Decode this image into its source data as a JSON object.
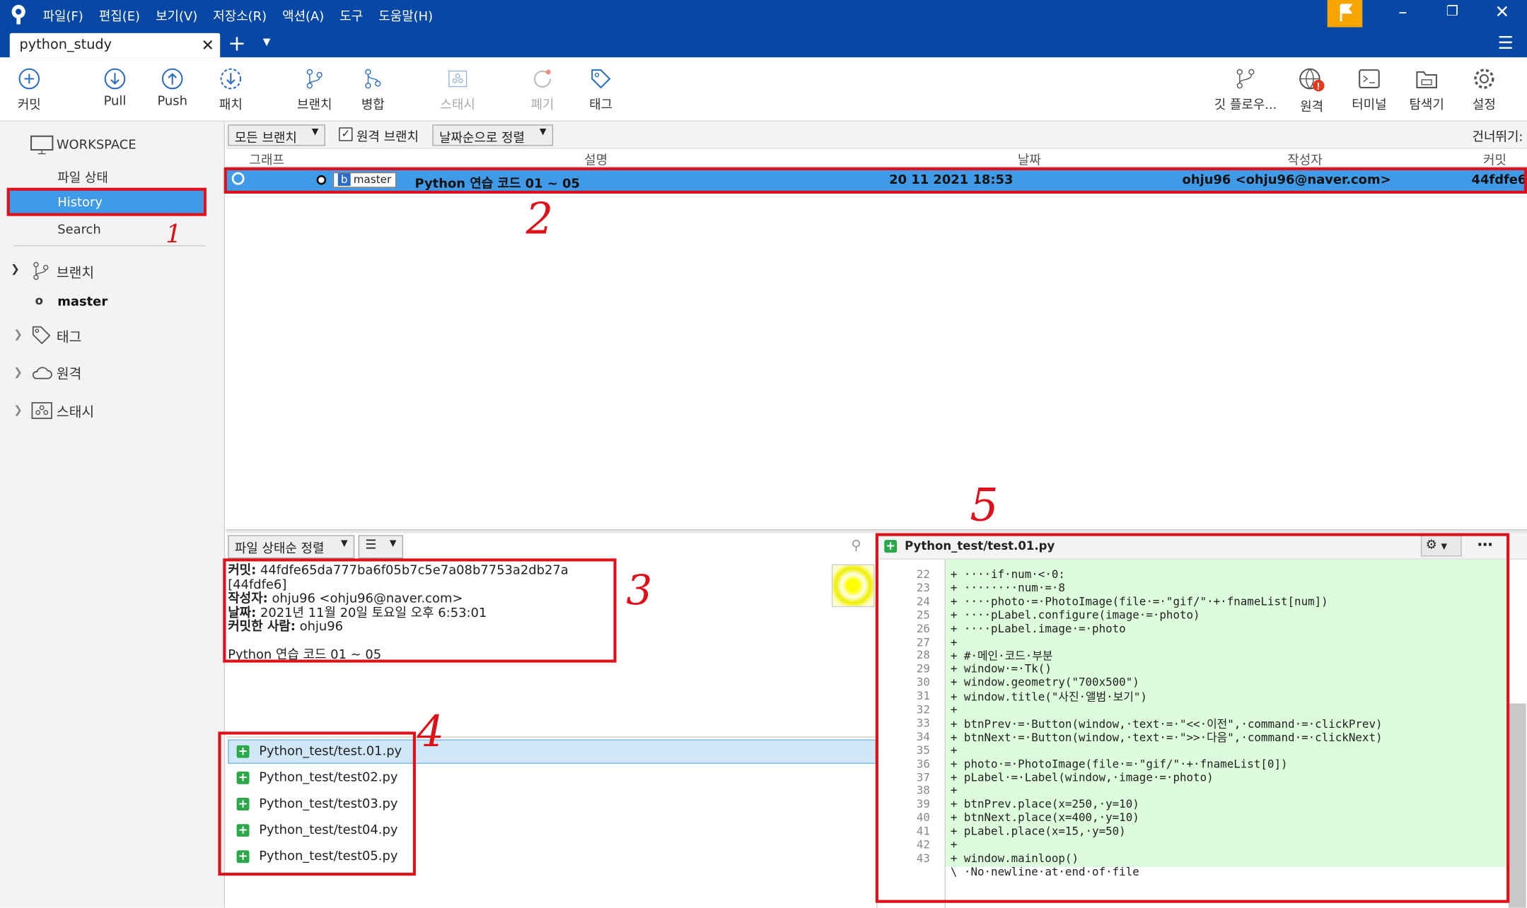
{
  "menu": [
    "파일(F)",
    "편집(E)",
    "보기(V)",
    "저장소(R)",
    "액션(A)",
    "도구",
    "도움말(H)"
  ],
  "tab": {
    "title": "python_study"
  },
  "toolbar": {
    "commit": "커밋",
    "pull": "Pull",
    "push": "Push",
    "patch": "패치",
    "branch": "브랜치",
    "merge": "병합",
    "stash": "스태시",
    "discard": "폐기",
    "tag": "태그",
    "gitflow": "깃 플로우...",
    "remote": "원격",
    "terminal": "터미널",
    "explorer": "탐색기",
    "settings": "설정"
  },
  "sidebar": {
    "workspace": "WORKSPACE",
    "file_status": "파일 상태",
    "history": "History",
    "search": "Search",
    "branches": "브랜치",
    "master": "master",
    "tags": "태그",
    "remotes": "원격",
    "stashes": "스태시"
  },
  "filter": {
    "branches": "모든 브랜치",
    "remote_branches": "원격 브랜치",
    "sort": "날짜순으로 정렬",
    "jump_to": "건너뛰기:"
  },
  "columns": {
    "graph": "그래프",
    "description": "설명",
    "date": "날짜",
    "author": "작성자",
    "commit": "커밋"
  },
  "commit_row": {
    "branch_tag": "master",
    "message": "Python 연습 코드 01 ~ 05",
    "date": "20 11 2021 18:53",
    "author": "ohju96 <ohju96@naver.com>",
    "hash": "44fdfe6"
  },
  "details": {
    "sort": "파일 상태순 정렬",
    "commit_label": "커밋:",
    "commit_value": "44fdfe65da777ba6f05b7c5e7a08b7753a2db27a [44fdfe6]",
    "author_label": "작성자:",
    "author_value": "ohju96 <ohju96@naver.com>",
    "date_label": "날짜:",
    "date_value": "2021년 11월 20일 토요일 오후 6:53:01",
    "committer_label": "커밋한 사람:",
    "committer_value": "ohju96",
    "message": "Python 연습 코드 01 ~ 05"
  },
  "files": [
    "Python_test/test.01.py",
    "Python_test/test02.py",
    "Python_test/test03.py",
    "Python_test/test04.py",
    "Python_test/test05.py"
  ],
  "diff": {
    "filename": "Python_test/test.01.py",
    "line_numbers": [
      "22",
      "23",
      "24",
      "25",
      "26",
      "27",
      "28",
      "29",
      "30",
      "31",
      "32",
      "33",
      "34",
      "35",
      "36",
      "37",
      "38",
      "39",
      "40",
      "41",
      "42",
      "43"
    ],
    "lines": [
      "+ ····if·num·<·0:",
      "+ ········num·=·8",
      "+ ····photo·=·PhotoImage(file·=·\"gif/\"·+·fnameList[num])",
      "+ ····pLabel.configure(image·=·photo)",
      "+ ····pLabel.image·=·photo",
      "+",
      "+ #·메인·코드·부분",
      "+ window·=·Tk()",
      "+ window.geometry(\"700x500\")",
      "+ window.title(\"사진·앨범·보기\")",
      "+",
      "+ btnPrev·=·Button(window,·text·=·\"<<·이전\",·command·=·clickPrev)",
      "+ btnNext·=·Button(window,·text·=·\">>·다음\",·command·=·clickNext)",
      "+",
      "+ photo·=·PhotoImage(file·=·\"gif/\"·+·fnameList[0])",
      "+ pLabel·=·Label(window,·image·=·photo)",
      "+",
      "+ btnPrev.place(x=250,·y=10)",
      "+ btnNext.place(x=400,·y=10)",
      "+ pLabel.place(x=15,·y=50)",
      "+",
      "+ window.mainloop()"
    ],
    "no_newline": "\\ ·No·newline·at·end·of·file"
  },
  "annotations": [
    "1",
    "2",
    "3",
    "4",
    "5"
  ],
  "colors": {
    "titlebar": "#0747a6",
    "selection": "#3f9be8",
    "annotation": "#e0101a",
    "diff_add": "#dcfcdc"
  }
}
